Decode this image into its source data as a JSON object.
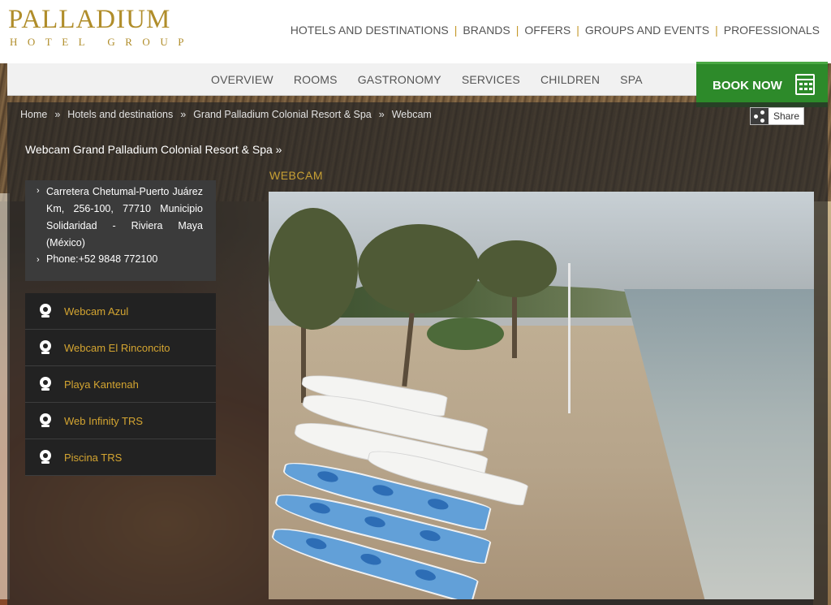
{
  "logo": {
    "main": "PALLADIUM",
    "sub": "HOTEL GROUP",
    "color": "#b08d2a"
  },
  "top_nav": [
    {
      "label": "HOTELS AND DESTINATIONS"
    },
    {
      "label": "BRANDS"
    },
    {
      "label": "OFFERS"
    },
    {
      "label": "GROUPS AND EVENTS"
    },
    {
      "label": "PROFESSIONALS"
    }
  ],
  "sub_nav": [
    {
      "label": "OVERVIEW"
    },
    {
      "label": "ROOMS"
    },
    {
      "label": "GASTRONOMY"
    },
    {
      "label": "SERVICES"
    },
    {
      "label": "CHILDREN"
    },
    {
      "label": "SPA"
    }
  ],
  "book_now": {
    "label": "BOOK NOW",
    "icon": "calendar-icon",
    "color": "#2d8a2a"
  },
  "breadcrumb": [
    {
      "label": "Home"
    },
    {
      "label": "Hotels and destinations"
    },
    {
      "label": "Grand Palladium Colonial Resort & Spa"
    },
    {
      "label": "Webcam"
    }
  ],
  "breadcrumb_separator": "»",
  "share": {
    "label": "Share",
    "icon": "share-icon"
  },
  "hotel_title": "Webcam Grand Palladium Colonial Resort & Spa »",
  "section_title": "WEBCAM",
  "info": {
    "bullet": "›",
    "address": "Carretera Chetumal-Puerto Juárez Km, 256-100, 77710 Municipio Solidaridad - Riviera Maya (México)",
    "phone": "Phone:+52 9848 772100"
  },
  "webcams": [
    {
      "label": "Webcam Azul",
      "icon": "webcam-icon"
    },
    {
      "label": "Webcam El Rinconcito",
      "icon": "webcam-icon"
    },
    {
      "label": "Playa Kantenah",
      "icon": "webcam-icon"
    },
    {
      "label": "Web Infinity TRS",
      "icon": "webcam-icon"
    },
    {
      "label": "Piscina TRS",
      "icon": "webcam-icon"
    }
  ],
  "accent_color": "#d4a531"
}
